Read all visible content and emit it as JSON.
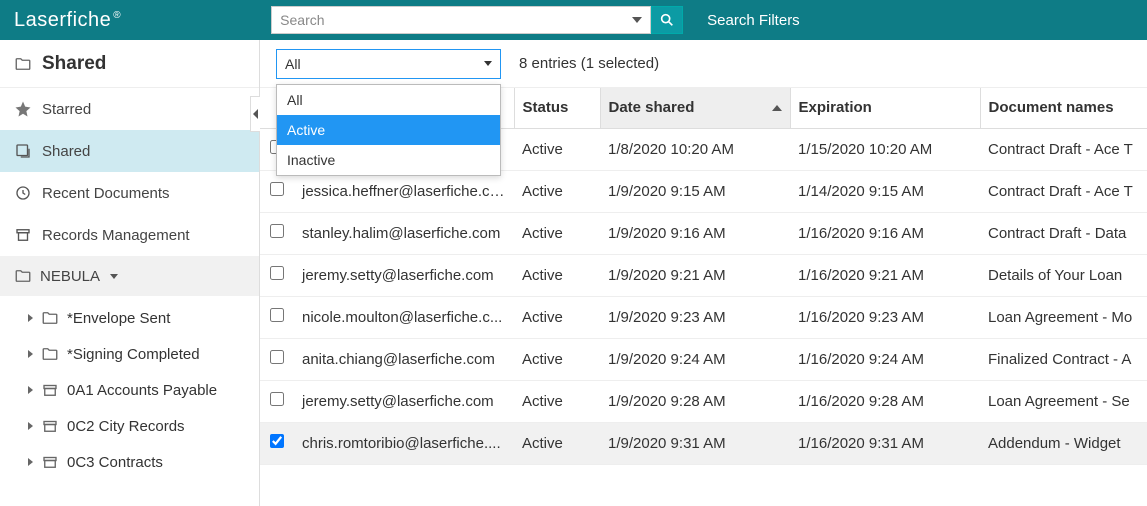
{
  "brand": "Laserfiche",
  "search": {
    "placeholder": "Search"
  },
  "search_filters_label": "Search Filters",
  "sidebar": {
    "title": "Shared",
    "nav": [
      {
        "label": "Starred",
        "selected": false,
        "icon": "star"
      },
      {
        "label": "Shared",
        "selected": true,
        "icon": "share"
      },
      {
        "label": "Recent Documents",
        "selected": false,
        "icon": "clock"
      },
      {
        "label": "Records Management",
        "selected": false,
        "icon": "records"
      }
    ],
    "repo": {
      "name": "NEBULA",
      "items": [
        {
          "label": "*Envelope Sent",
          "icon": "folder"
        },
        {
          "label": "*Signing Completed",
          "icon": "folder"
        },
        {
          "label": "0A1 Accounts Payable",
          "icon": "box"
        },
        {
          "label": "0C2 City Records",
          "icon": "box"
        },
        {
          "label": "0C3 Contracts",
          "icon": "box"
        }
      ]
    }
  },
  "filter": {
    "value": "All",
    "options": [
      "All",
      "Active",
      "Inactive"
    ],
    "highlighted_index": 1
  },
  "entries_label": "8 entries (1 selected)",
  "columns": {
    "email": "",
    "status": "Status",
    "date_shared": "Date shared",
    "expiration": "Expiration",
    "doc": "Document names"
  },
  "sort": {
    "column": "date_shared",
    "dir": "asc"
  },
  "rows": [
    {
      "checked": false,
      "email": "",
      "status": "Active",
      "date_shared": "1/8/2020 10:20 AM",
      "expiration": "1/15/2020 10:20 AM",
      "doc": "Contract Draft - Ace T"
    },
    {
      "checked": false,
      "email": "jessica.heffner@laserfiche.co...",
      "status": "Active",
      "date_shared": "1/9/2020 9:15 AM",
      "expiration": "1/14/2020 9:15 AM",
      "doc": "Contract Draft - Ace T"
    },
    {
      "checked": false,
      "email": "stanley.halim@laserfiche.com",
      "status": "Active",
      "date_shared": "1/9/2020 9:16 AM",
      "expiration": "1/16/2020 9:16 AM",
      "doc": "Contract Draft - Data"
    },
    {
      "checked": false,
      "email": "jeremy.setty@laserfiche.com",
      "status": "Active",
      "date_shared": "1/9/2020 9:21 AM",
      "expiration": "1/16/2020 9:21 AM",
      "doc": "Details of Your Loan"
    },
    {
      "checked": false,
      "email": "nicole.moulton@laserfiche.c...",
      "status": "Active",
      "date_shared": "1/9/2020 9:23 AM",
      "expiration": "1/16/2020 9:23 AM",
      "doc": "Loan Agreement - Mo"
    },
    {
      "checked": false,
      "email": "anita.chiang@laserfiche.com",
      "status": "Active",
      "date_shared": "1/9/2020 9:24 AM",
      "expiration": "1/16/2020 9:24 AM",
      "doc": "Finalized Contract - A"
    },
    {
      "checked": false,
      "email": "jeremy.setty@laserfiche.com",
      "status": "Active",
      "date_shared": "1/9/2020 9:28 AM",
      "expiration": "1/16/2020 9:28 AM",
      "doc": "Loan Agreement - Se"
    },
    {
      "checked": true,
      "email": "chris.romtoribio@laserfiche....",
      "status": "Active",
      "date_shared": "1/9/2020 9:31 AM",
      "expiration": "1/16/2020 9:31 AM",
      "doc": "Addendum - Widget"
    }
  ]
}
